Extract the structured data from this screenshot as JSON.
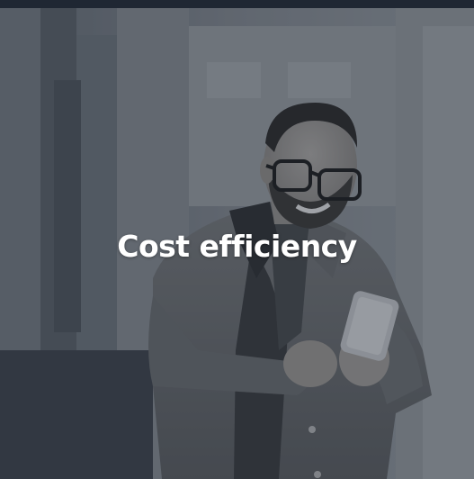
{
  "card": {
    "title": "Cost efficiency",
    "image_subject": "smiling-man-holding-smartphone-photo"
  },
  "colors": {
    "top_bar": "#1f2733",
    "overlay": "#1e2632",
    "title_text": "#ffffff"
  }
}
